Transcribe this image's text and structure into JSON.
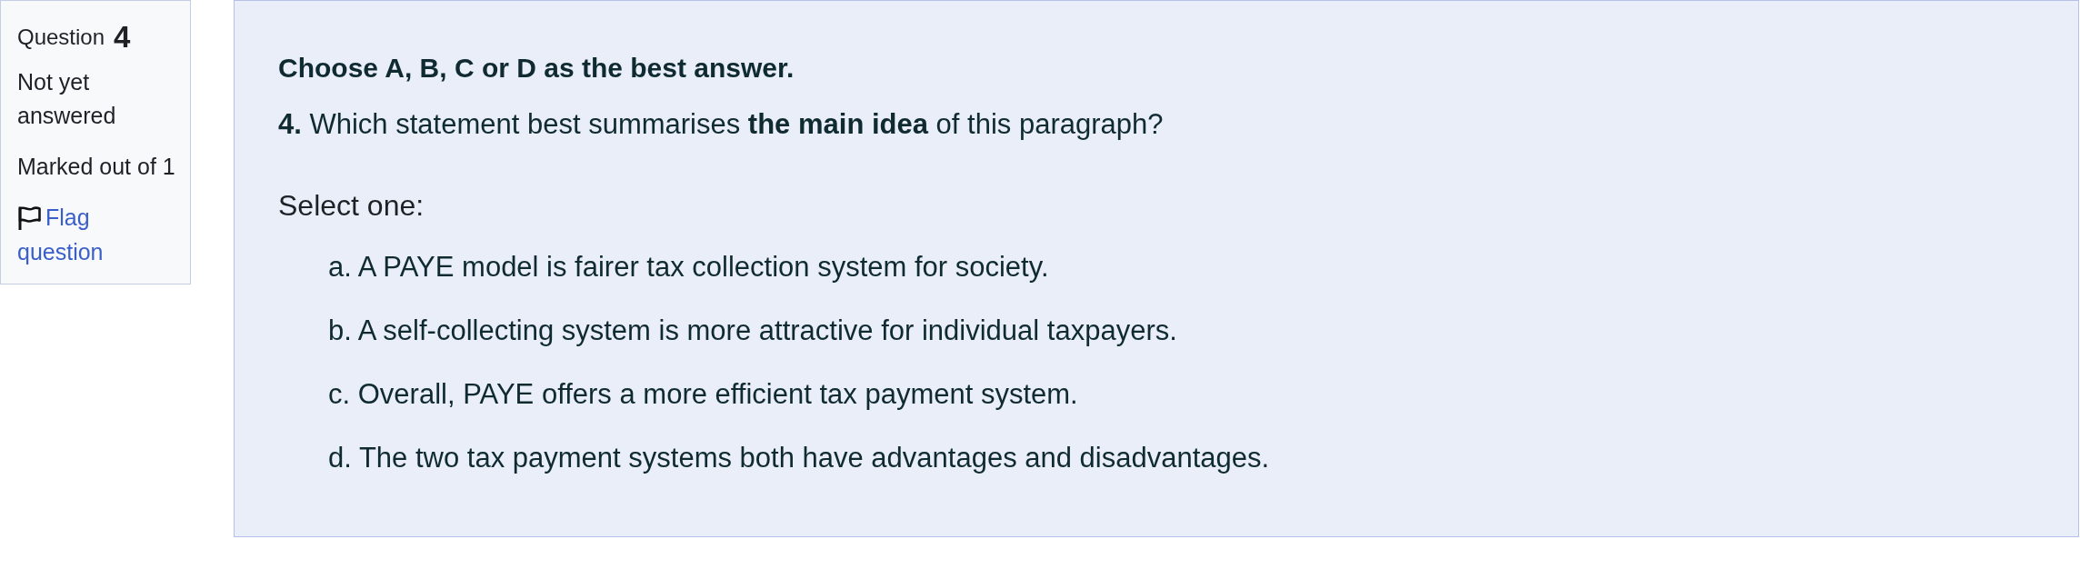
{
  "question_info": {
    "label": "Question",
    "number": "4",
    "state": "Not yet answered",
    "grade": "Marked out of 1",
    "flag": {
      "label": "Flag question",
      "flagged": false
    }
  },
  "content": {
    "instruction": "Choose A, B, C or D as the best answer.",
    "question": "**4.** Which statement best summarises **the main idea** of this paragraph?",
    "prompt": "Select one:",
    "options": [
      {
        "letter": "a.",
        "text": "A PAYE model is fairer tax collection system for society."
      },
      {
        "letter": "b.",
        "text": "A self-collecting system is more attractive for individual taxpayers."
      },
      {
        "letter": "c.",
        "text": "Overall, PAYE offers a more efficient tax payment system."
      },
      {
        "letter": "d.",
        "text": "The two tax payment systems both have advantages and disadvantages."
      }
    ]
  }
}
